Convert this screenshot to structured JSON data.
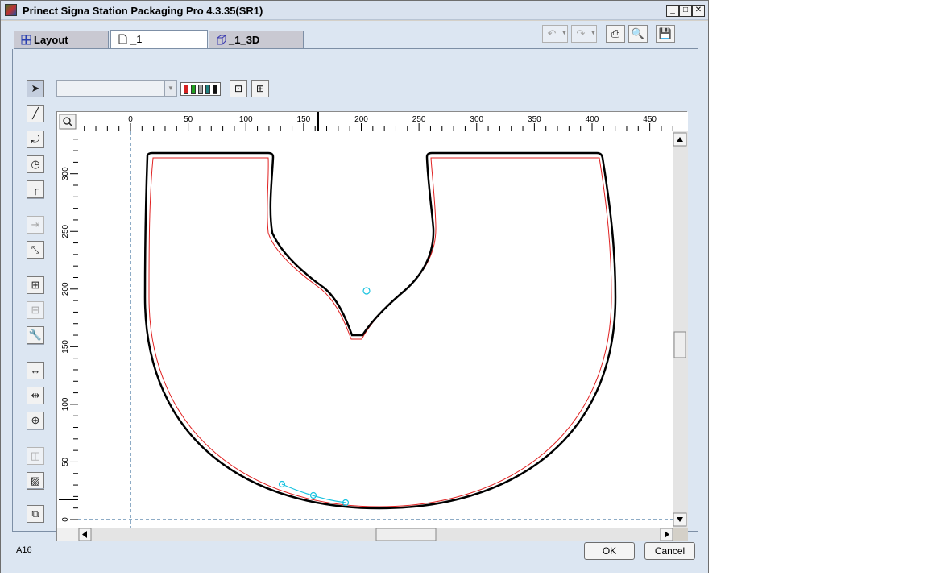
{
  "window": {
    "title": "Prinect Signa Station Packaging Pro 4.3.35(SR1)"
  },
  "window_controls": {
    "minimize": "_",
    "maximize": "□",
    "close": "✕"
  },
  "tabs": [
    {
      "label": "Layout",
      "icon": "layout-grid-icon",
      "active": false
    },
    {
      "label": "_1",
      "icon": "page-icon",
      "active": true
    },
    {
      "label": "_1_3D",
      "icon": "cube-3d-icon",
      "active": false
    }
  ],
  "toolbar": {
    "undo": "↶",
    "redo": "↷",
    "print": "⎙",
    "preview": "🔍",
    "save": "💾"
  },
  "tools": [
    {
      "name": "pointer-tool-icon",
      "glyph": "➤"
    },
    {
      "name": "line-tool-icon",
      "glyph": "╱"
    },
    {
      "name": "arc-tool-icon",
      "glyph": "⤾"
    },
    {
      "name": "circle-tool-icon",
      "glyph": "◷"
    },
    {
      "name": "fillet-tool-icon",
      "glyph": "╭"
    },
    {
      "name": "insert-tool-icon",
      "glyph": "⇥"
    },
    {
      "name": "split-tool-icon",
      "glyph": "⤡"
    },
    {
      "name": "grid-tool-icon",
      "glyph": "⊞"
    },
    {
      "name": "offset-tool-icon",
      "glyph": "⊟"
    },
    {
      "name": "wrench-tool-icon",
      "glyph": "🔧"
    },
    {
      "name": "horizontal-dimension-icon",
      "glyph": "↔"
    },
    {
      "name": "vertical-dimension-icon",
      "glyph": "⇹"
    },
    {
      "name": "table-dimension-icon",
      "glyph": "⊕"
    },
    {
      "name": "layer-tool-icon",
      "glyph": "◫"
    },
    {
      "name": "hatch-tool-icon",
      "glyph": "▨"
    },
    {
      "name": "window-tool-icon",
      "glyph": "⧉"
    }
  ],
  "colors": {
    "cut_line": "#000000",
    "bleed_line": "#e02020",
    "marker": "#19c3e0",
    "guide": "#1e5a8c"
  },
  "ruler": {
    "x_ticks": [
      "0",
      "50",
      "100",
      "150",
      "200",
      "250",
      "300",
      "350",
      "400",
      "450"
    ],
    "y_ticks": [
      "300",
      "250",
      "200",
      "150",
      "100",
      "50",
      "0"
    ]
  },
  "statusbar": {
    "text": "A16"
  },
  "buttons": {
    "ok": "OK",
    "cancel": "Cancel"
  }
}
